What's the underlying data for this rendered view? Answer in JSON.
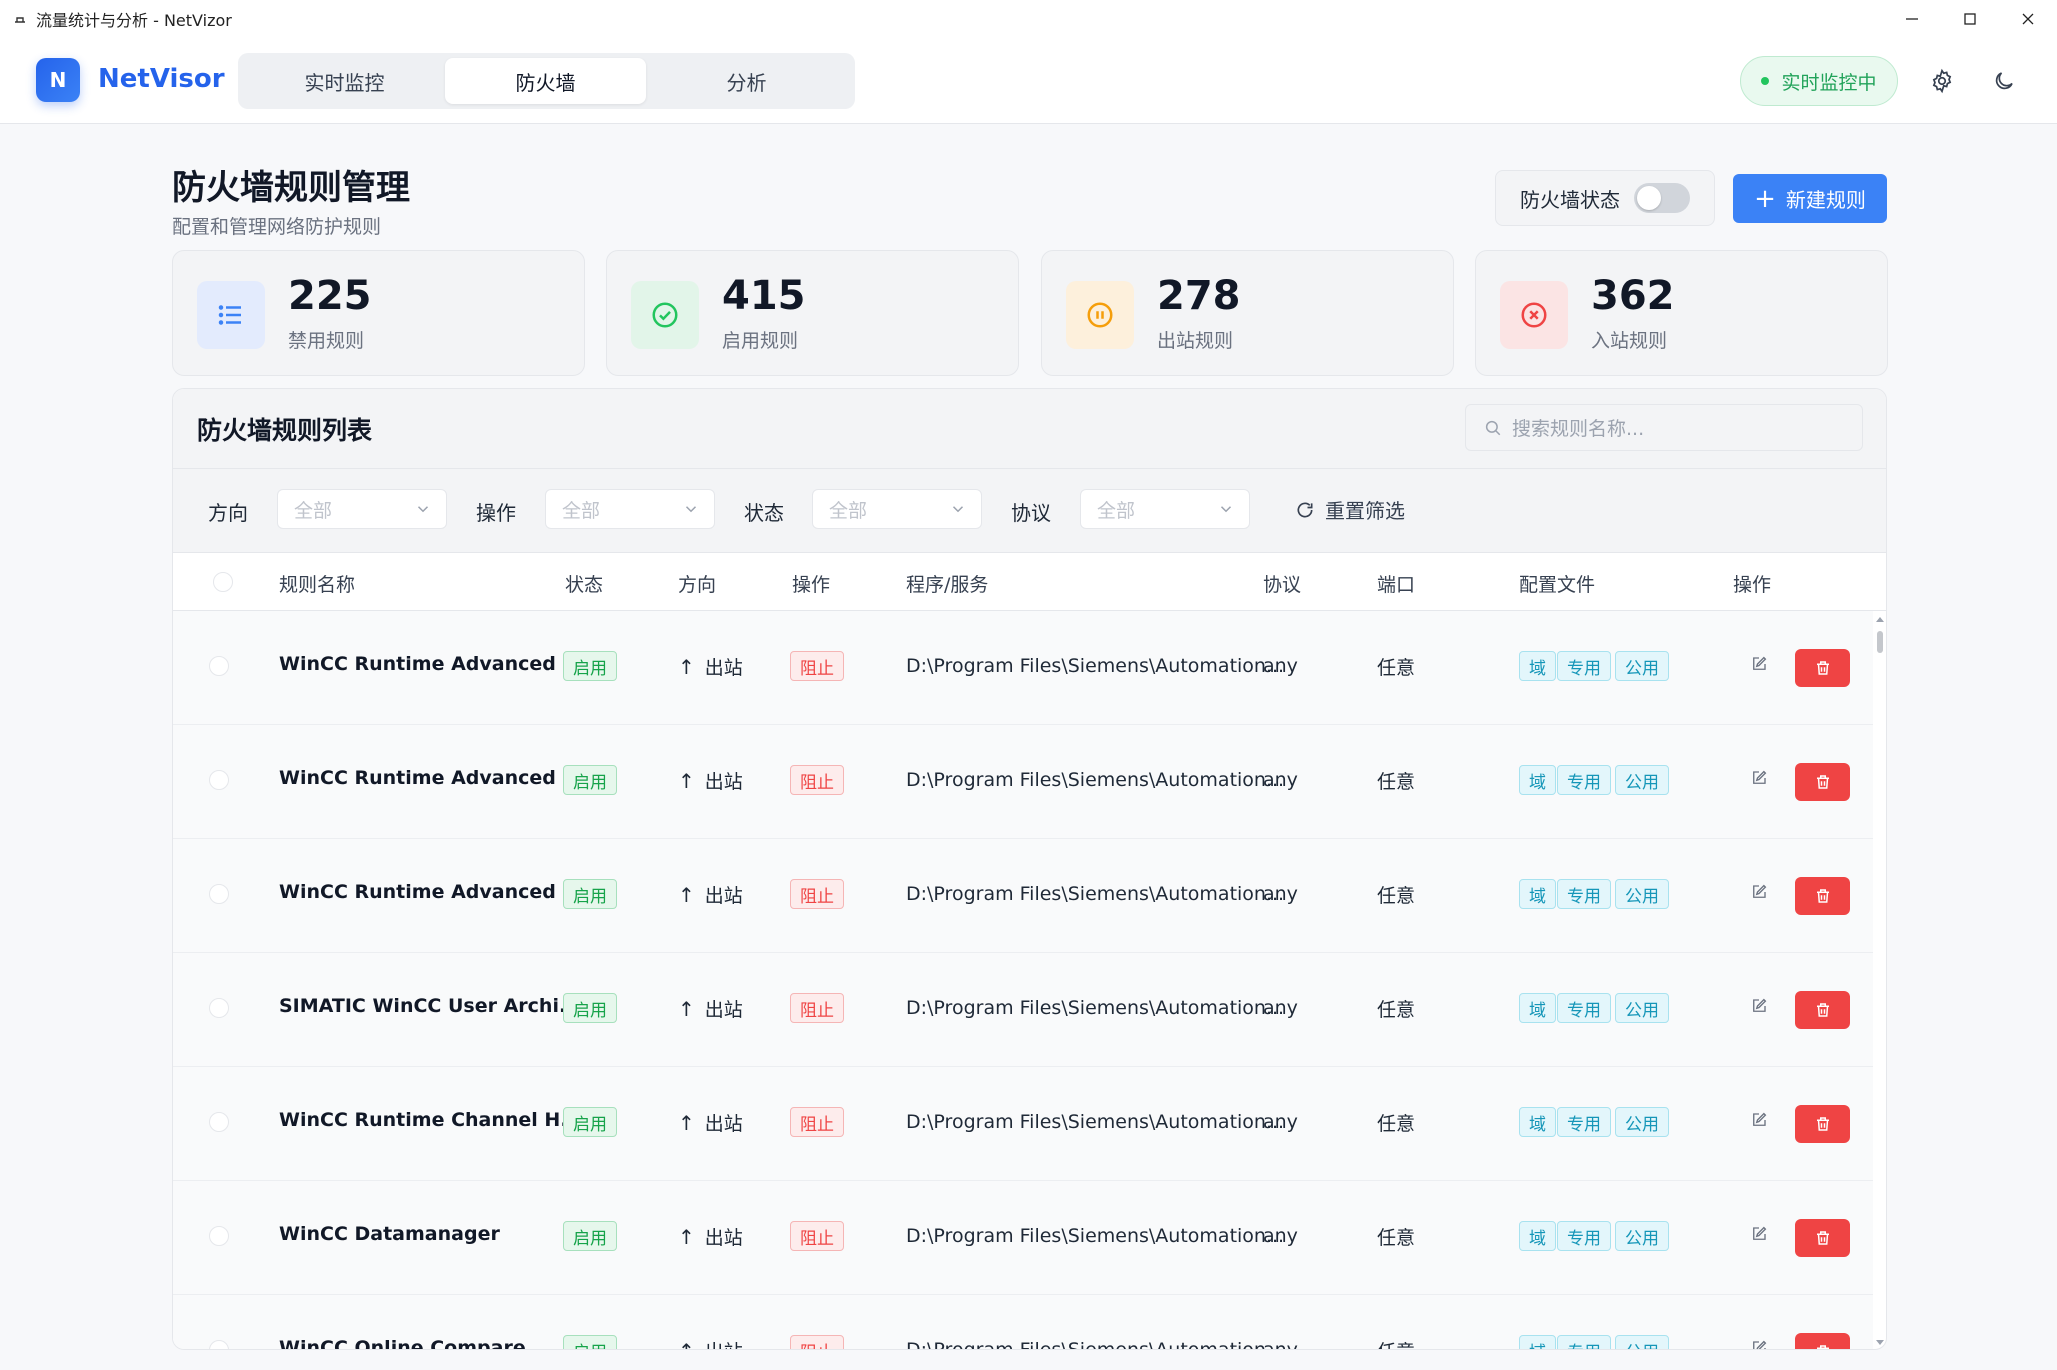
{
  "window": {
    "title": "流量统计与分析 - NetVizor"
  },
  "header": {
    "logo_letter": "N",
    "app_name": "NetVisor",
    "tabs": [
      {
        "label": "实时监控"
      },
      {
        "label": "防火墙"
      },
      {
        "label": "分析"
      }
    ],
    "active_tab": "防火墙",
    "live_status": "实时监控中"
  },
  "page": {
    "title": "防火墙规则管理",
    "subtitle": "配置和管理网络防护规则",
    "firewall_status_label": "防火墙状态",
    "firewall_enabled": false,
    "new_rule_label": "新建规则"
  },
  "stats": [
    {
      "value": "225",
      "label": "禁用规则",
      "icon": "list-icon",
      "color": "#3b82f6"
    },
    {
      "value": "415",
      "label": "启用规则",
      "icon": "check-circle-icon",
      "color": "#22c55e"
    },
    {
      "value": "278",
      "label": "出站规则",
      "icon": "pause-circle-icon",
      "color": "#f59e0b"
    },
    {
      "value": "362",
      "label": "入站规则",
      "icon": "x-circle-icon",
      "color": "#ef4444"
    }
  ],
  "rules_panel": {
    "title": "防火墙规则列表",
    "search_placeholder": "搜索规则名称...",
    "filters": [
      {
        "label": "方向",
        "value": "全部"
      },
      {
        "label": "操作",
        "value": "全部"
      },
      {
        "label": "状态",
        "value": "全部"
      },
      {
        "label": "协议",
        "value": "全部"
      }
    ],
    "reset_label": "重置筛选",
    "columns": [
      "规则名称",
      "状态",
      "方向",
      "操作",
      "程序/服务",
      "协议",
      "端口",
      "配置文件",
      "操作"
    ],
    "rows": [
      {
        "name": "WinCC Runtime Advanced ...",
        "status": "启用",
        "direction": "出站",
        "action": "阻止",
        "program": "D:\\Program Files\\Siemens\\Automation...",
        "protocol": "any",
        "port": "任意",
        "profiles": [
          "域",
          "专用",
          "公用"
        ]
      },
      {
        "name": "WinCC Runtime Advanced ...",
        "status": "启用",
        "direction": "出站",
        "action": "阻止",
        "program": "D:\\Program Files\\Siemens\\Automation...",
        "protocol": "any",
        "port": "任意",
        "profiles": [
          "域",
          "专用",
          "公用"
        ]
      },
      {
        "name": "WinCC Runtime Advanced ...",
        "status": "启用",
        "direction": "出站",
        "action": "阻止",
        "program": "D:\\Program Files\\Siemens\\Automation...",
        "protocol": "any",
        "port": "任意",
        "profiles": [
          "域",
          "专用",
          "公用"
        ]
      },
      {
        "name": "SIMATIC WinCC User Archi...",
        "status": "启用",
        "direction": "出站",
        "action": "阻止",
        "program": "D:\\Program Files\\Siemens\\Automation...",
        "protocol": "any",
        "port": "任意",
        "profiles": [
          "域",
          "专用",
          "公用"
        ]
      },
      {
        "name": "WinCC Runtime Channel H...",
        "status": "启用",
        "direction": "出站",
        "action": "阻止",
        "program": "D:\\Program Files\\Siemens\\Automation...",
        "protocol": "any",
        "port": "任意",
        "profiles": [
          "域",
          "专用",
          "公用"
        ]
      },
      {
        "name": "WinCC Datamanager",
        "status": "启用",
        "direction": "出站",
        "action": "阻止",
        "program": "D:\\Program Files\\Siemens\\Automation...",
        "protocol": "any",
        "port": "任意",
        "profiles": [
          "域",
          "专用",
          "公用"
        ]
      },
      {
        "name": "WinCC Online Compare",
        "status": "启用",
        "direction": "出站",
        "action": "阻止",
        "program": "D:\\Program Files\\Siemens\\Automation...",
        "protocol": "any",
        "port": "任意",
        "profiles": [
          "域",
          "专用",
          "公用"
        ]
      }
    ]
  }
}
